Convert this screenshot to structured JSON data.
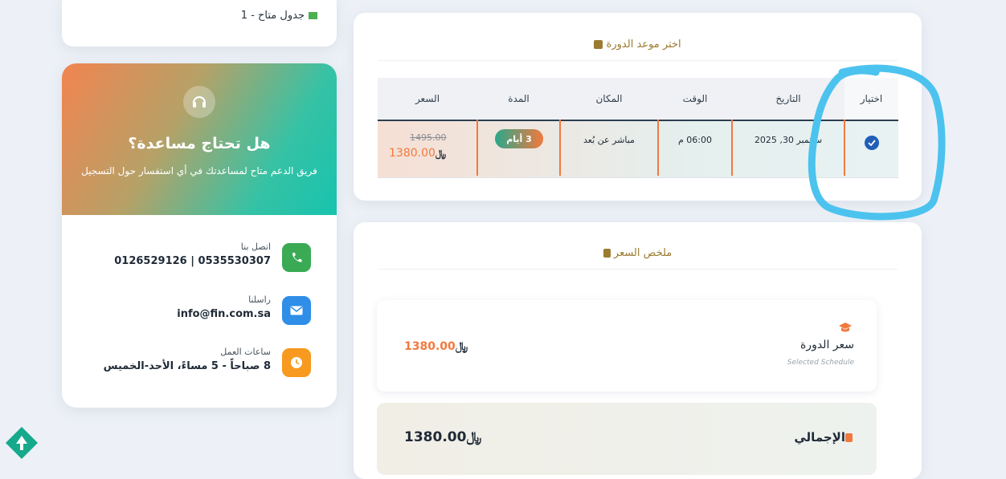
{
  "top_card": {
    "text": "1 - جدول متاح"
  },
  "help": {
    "title": "هل تحتاج مساعدة؟",
    "subtitle": "فريق الدعم متاح لمساعدتك في أي استفسار حول التسجيل",
    "contacts": [
      {
        "label": "اتصل بنا",
        "value": "0535530307 | 0126529126",
        "icon": "phone-icon",
        "color": "#3aaa55"
      },
      {
        "label": "راسلنا",
        "value": "info@fin.com.sa",
        "icon": "mail-icon",
        "color": "#2e8ee8"
      },
      {
        "label": "ساعات العمل",
        "value": "8 صباحاً - 5 مساءً، الأحد-الخميس",
        "icon": "clock-icon",
        "color": "#f79a1f"
      }
    ]
  },
  "schedule": {
    "title": "اختر موعد الدورة",
    "headers": {
      "select": "اختيار",
      "date": "التاريخ",
      "time": "الوقت",
      "place": "المكان",
      "duration": "المدة",
      "price": "السعر"
    },
    "row": {
      "date": "سبتمبر 30, 2025",
      "time": "06:00 م",
      "place": "مباشر عن بُعد",
      "duration": "3 أيام",
      "old_price": "1495.00",
      "new_price": "1380.00"
    }
  },
  "summary": {
    "title": "ملخص السعر",
    "course_label": "سعر الدورة",
    "course_sub": "Selected Schedule",
    "course_price": "1380.00",
    "total_label": "الإجمالي",
    "total_price": "1380.00"
  },
  "colors": {
    "accent_orange": "#f2793e",
    "gold": "#9a7b30",
    "annotation_blue": "#4cc3ee"
  }
}
